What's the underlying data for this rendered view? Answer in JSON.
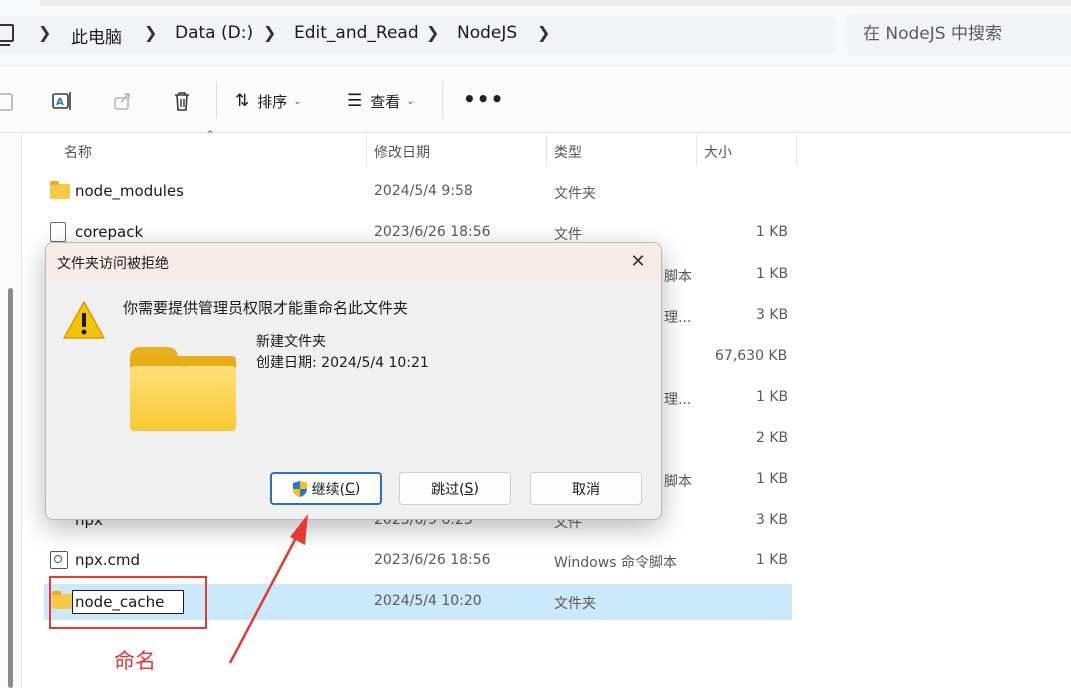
{
  "address_bar": {
    "crumbs": [
      "此电脑",
      "Data (D:)",
      "Edit_and_Read",
      "NodeJS"
    ],
    "search_placeholder": "在 NodeJS 中搜索"
  },
  "toolbar": {
    "sort_label": "排序",
    "view_label": "查看",
    "more_label": "•••"
  },
  "columns": {
    "name": "名称",
    "date": "修改日期",
    "type": "类型",
    "size": "大小"
  },
  "files": [
    {
      "name": "node_modules",
      "date": "2024/5/4 9:58",
      "type": "文件夹",
      "size": "",
      "icon": "folder-icon"
    },
    {
      "name": "corepack",
      "date": "2023/6/26 18:56",
      "type": "文件",
      "size": "1 KB",
      "icon": "file-icon"
    }
  ],
  "partially_hidden": {
    "types": [
      "脚本",
      "理...",
      "理...",
      "脚本"
    ],
    "sizes": [
      "1 KB",
      "3 KB",
      "67,630 KB",
      "1 KB",
      "2 KB",
      "1 KB"
    ],
    "npx_row": {
      "name": "npx",
      "date": "2023/6/9 6:23",
      "type": "文件",
      "size": "3 KB"
    }
  },
  "files_after": [
    {
      "name": "npx.cmd",
      "date": "2023/6/26 18:56",
      "type": "Windows 命令脚本",
      "size": "1 KB",
      "icon": "cmd-icon"
    }
  ],
  "selected_row": {
    "name_value": "node_cache",
    "date": "2024/5/4 10:20",
    "type": "文件夹"
  },
  "dialog": {
    "title": "文件夹访问被拒绝",
    "message": "你需要提供管理员权限才能重命名此文件夹",
    "folder_name": "新建文件夹",
    "created": "创建日期: 2024/5/4 10:21",
    "continue_label": "继续(",
    "continue_key": "C",
    "skip_label": "跳过(",
    "skip_key": "S",
    "cancel_label": "取消",
    "close_glyph": "✕"
  },
  "annotation": {
    "label": "命名",
    "color": "#e53935"
  }
}
